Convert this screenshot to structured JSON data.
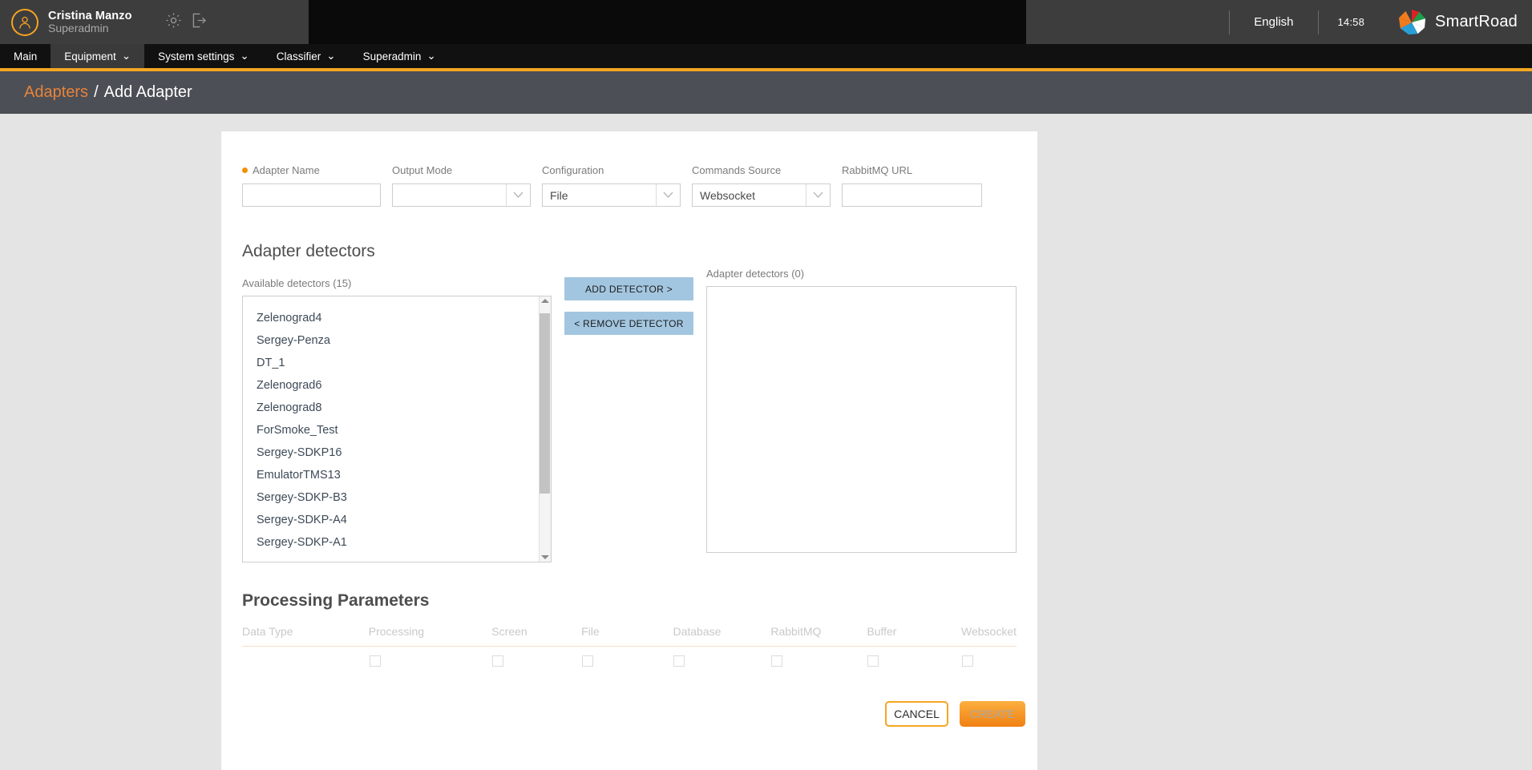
{
  "topbar": {
    "user_name": "Cristina Manzo",
    "user_role": "Superadmin",
    "settings_icon": "gear-icon",
    "logout_icon": "logout-icon",
    "language": "English",
    "time": "14:58",
    "brand": "SmartRoad",
    "accent_color": "#f5a623"
  },
  "nav": {
    "items": [
      {
        "label": "Main",
        "caret": "",
        "active": false
      },
      {
        "label": "Equipment",
        "caret": "⌄",
        "active": true
      },
      {
        "label": "System settings",
        "caret": "⌄",
        "active": false
      },
      {
        "label": "Classifier",
        "caret": "⌄",
        "active": false
      },
      {
        "label": "Superadmin",
        "caret": "⌄",
        "active": false
      }
    ]
  },
  "breadcrumb": {
    "parent": "Adapters",
    "separator": "/",
    "current": "Add Adapter"
  },
  "form": {
    "adapter_name": {
      "label": "Adapter Name",
      "value": "",
      "required": true
    },
    "output_mode": {
      "label": "Output Mode",
      "value": ""
    },
    "configuration": {
      "label": "Configuration",
      "value": "File"
    },
    "commands_source": {
      "label": "Commands Source",
      "value": "Websocket"
    },
    "rabbitmq_url": {
      "label": "RabbitMQ URL",
      "value": ""
    }
  },
  "detectors": {
    "section_title": "Adapter detectors",
    "available_label": "Available detectors (15)",
    "available": [
      "Zelenograd4",
      "Sergey-Penza",
      "DT_1",
      "Zelenograd6",
      "Zelenograd8",
      "ForSmoke_Test",
      "Sergey-SDKP16",
      "EmulatorTMS13",
      "Sergey-SDKP-B3",
      "Sergey-SDKP-A4",
      "Sergey-SDKP-A1"
    ],
    "add_button": "ADD DETECTOR >",
    "remove_button": "< REMOVE DETECTOR",
    "selected_label": "Adapter detectors (0)",
    "selected": []
  },
  "processing": {
    "title": "Processing Parameters",
    "columns": [
      "Data Type",
      "Processing",
      "Screen",
      "File",
      "Database",
      "RabbitMQ",
      "Buffer",
      "Websocket"
    ],
    "rows": [
      {
        "data_type": "",
        "checks": [
          false,
          false,
          false,
          false,
          false,
          false,
          false
        ]
      }
    ]
  },
  "actions": {
    "cancel": "CANCEL",
    "create": "CREATE"
  }
}
